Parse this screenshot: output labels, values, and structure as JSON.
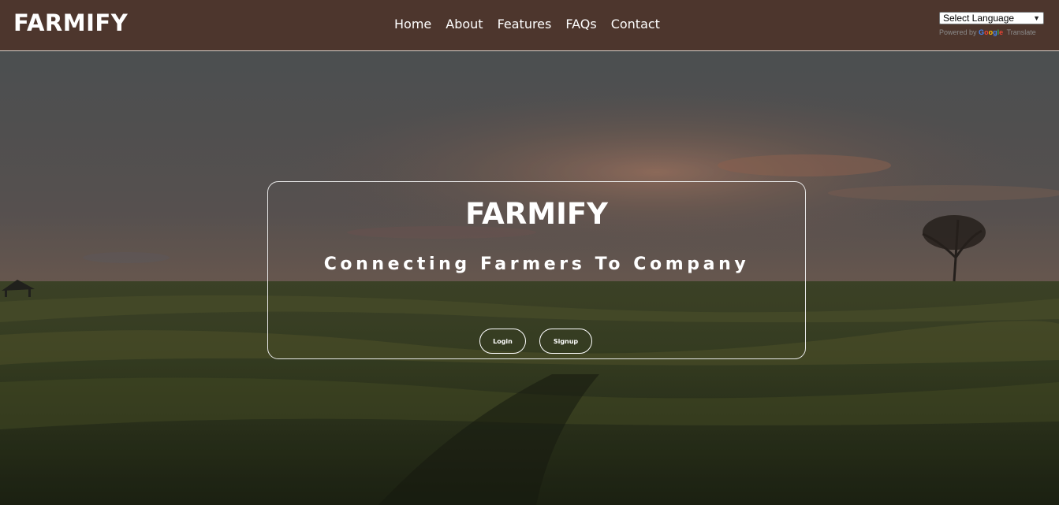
{
  "header": {
    "brand": "FARMIFY",
    "nav": [
      "Home",
      "About",
      "Features",
      "FAQs",
      "Contact"
    ]
  },
  "translate": {
    "select_value": "Select Language",
    "powered_by": "Powered by",
    "google": [
      "G",
      "o",
      "o",
      "g",
      "l",
      "e"
    ],
    "translate_word": "Translate"
  },
  "hero": {
    "title": "FARMIFY",
    "tagline": "Connecting Farmers To Company",
    "login_label": "Login",
    "signup_label": "Signup"
  },
  "colors": {
    "navbar": "#4d362d",
    "text": "#ffffff"
  }
}
